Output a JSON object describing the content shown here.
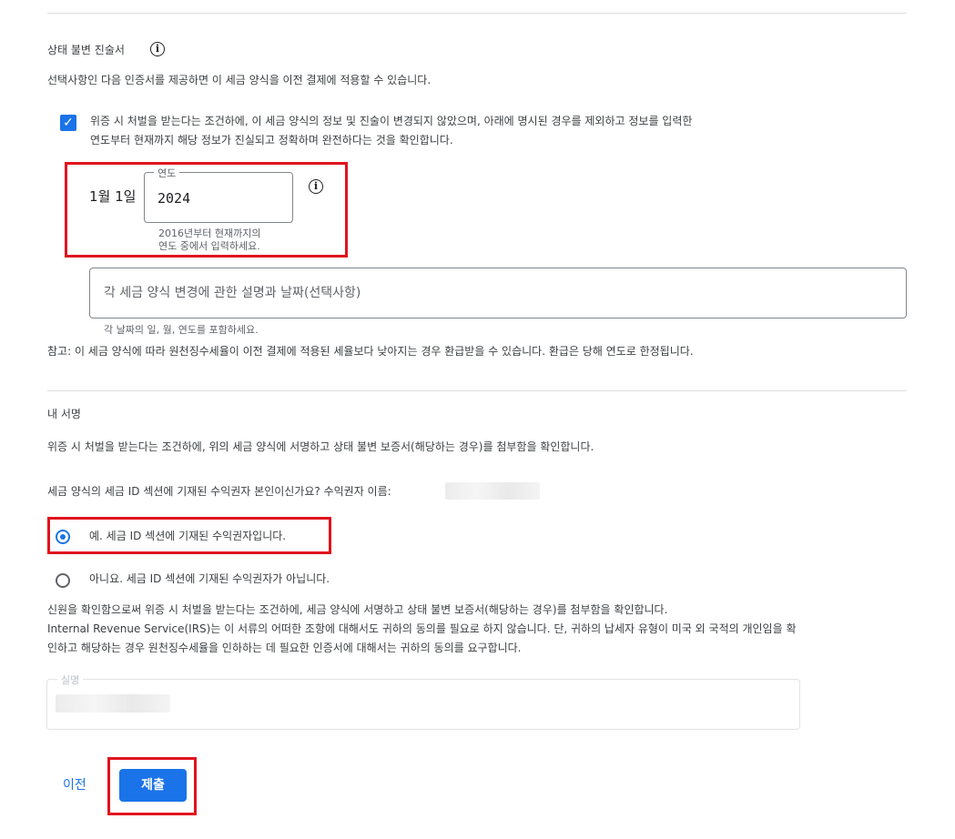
{
  "certification": {
    "title": "상태 불변 진술서",
    "intro": "선택사항인 다음 인증서를 제공하면 이 세금 양식을 이전 결제에 적용할 수 있습니다.",
    "checkbox_line1": "위증 시 처벌을 받는다는 조건하에, 이 세금 양식의 정보 및 진술이 변경되지 않았으며, 아래에 명시된 경우를 제외하고 정보를 입력한",
    "checkbox_line2": "연도부터 현재까지 해당 정보가 진실되고 정확하며 완전하다는 것을 확인합니다.",
    "checkbox_checked": true,
    "date_prefix": "1월 1일",
    "year_label": "연도",
    "year_value": "2024",
    "year_hint_line1": "2016년부터 현재까지의",
    "year_hint_line2": "연도 중에서 입력하세요.",
    "changes_placeholder": "각 세금 양식 변경에 관한 설명과 날짜(선택사항)",
    "changes_hint": "각 날짜의 일, 월, 연도를 포함하세요.",
    "note": "참고: 이 세금 양식에 따라 원천징수세율이 이전 결제에 적용된 세율보다 낮아지는 경우 환급받을 수 있습니다. 환급은 당해 연도로 한정됩니다."
  },
  "signature": {
    "title": "내 서명",
    "statement": "위증 시 처벌을 받는다는 조건하에, 위의 세금 양식에 서명하고 상태 불변 보증서(해당하는 경우)를 첨부함을 확인합니다.",
    "question": "세금 양식의 세금 ID 섹션에 기재된 수익권자 본인이신가요? 수익권자 이름:",
    "option_yes": "예. 세금 ID 섹션에 기재된 수익권자입니다.",
    "option_no": "아니요. 세금 ID 섹션에 기재된 수익권자가 아닙니다.",
    "selected": "yes",
    "consent_line1": "신원을 확인함으로써 위증 시 처벌을 받는다는 조건하에, 세금 양식에 서명하고 상태 불변 보증서(해당하는 경우)를 첨부함을 확인합니다.",
    "consent_line2": "Internal Revenue Service(IRS)는 이 서류의 어떠한 조항에 대해서도 귀하의 동의를 필요로 하지 않습니다. 단, 귀하의 납세자 유형이 미국 외 국적의 개인임을 확",
    "consent_line3": "인하고 해당하는 경우 원천징수세율을 인하하는 데 필요한 인증서에 대해서는 귀하의 동의를 요구합니다.",
    "name_label": "실명"
  },
  "actions": {
    "back_label": "이전",
    "submit_label": "제출"
  },
  "colors": {
    "accent": "#1a73e8",
    "highlight": "#e0141e"
  }
}
